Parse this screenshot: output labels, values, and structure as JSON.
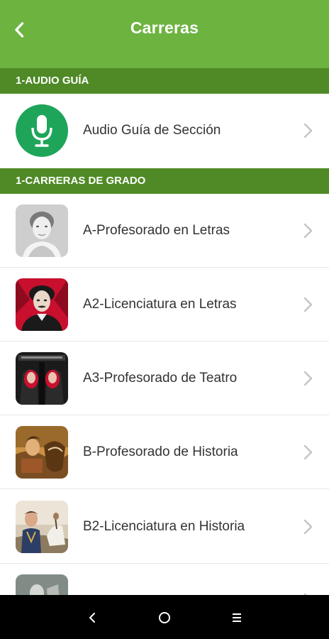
{
  "header": {
    "title": "Carreras"
  },
  "sections": [
    {
      "title": "1-AUDIO GUÍA",
      "items": [
        {
          "label": "Audio Guía de Sección",
          "icon": "microphone-icon"
        }
      ]
    },
    {
      "title": "1-CARRERAS DE GRADO",
      "items": [
        {
          "label": "A-Profesorado en Letras",
          "icon": "portrait-woman-thumbnail"
        },
        {
          "label": "A2-Licenciatura en Letras",
          "icon": "portrait-poe-thumbnail"
        },
        {
          "label": "A3-Profesorado de Teatro",
          "icon": "theatre-poster-thumbnail"
        },
        {
          "label": "B-Profesorado de Historia",
          "icon": "battle-painting-thumbnail"
        },
        {
          "label": "B2-Licenciatura en Historia",
          "icon": "general-painting-thumbnail"
        },
        {
          "label": "",
          "icon": "statue-thumbnail"
        }
      ]
    }
  ],
  "colors": {
    "header_bg": "#6cb33f",
    "section_bg": "#4f8a26",
    "mic_bg": "#1fa55a",
    "navbar_bg": "#000000"
  },
  "navbar": {
    "back_icon": "nav-back-icon",
    "home_icon": "nav-home-icon",
    "recents_icon": "nav-recents-icon"
  }
}
